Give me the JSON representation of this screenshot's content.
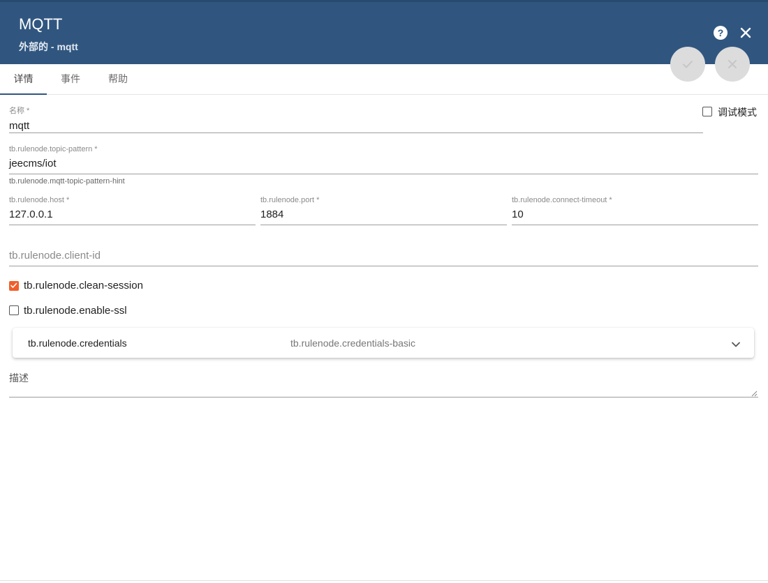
{
  "header": {
    "title": "MQTT",
    "subtitle": "外部的 - mqtt",
    "help_label": "?",
    "color": "#305680"
  },
  "tabs": [
    {
      "label": "详情",
      "active": true
    },
    {
      "label": "事件",
      "active": false
    },
    {
      "label": "帮助",
      "active": false
    }
  ],
  "form": {
    "name": {
      "label": "名称 *",
      "value": "mqtt"
    },
    "debug_mode": {
      "label": "调试模式",
      "checked": false
    },
    "topic_pattern": {
      "label": "tb.rulenode.topic-pattern *",
      "value": "jeecms/iot",
      "hint": "tb.rulenode.mqtt-topic-pattern-hint"
    },
    "host": {
      "label": "tb.rulenode.host *",
      "value": "127.0.0.1"
    },
    "port": {
      "label": "tb.rulenode.port *",
      "value": "1884"
    },
    "connect_timeout": {
      "label": "tb.rulenode.connect-timeout *",
      "value": "10"
    },
    "client_id": {
      "placeholder": "tb.rulenode.client-id",
      "value": ""
    },
    "clean_session": {
      "label": "tb.rulenode.clean-session",
      "checked": true
    },
    "enable_ssl": {
      "label": "tb.rulenode.enable-ssl",
      "checked": false
    },
    "credentials": {
      "title": "tb.rulenode.credentials",
      "description": "tb.rulenode.credentials-basic"
    },
    "description": {
      "label": "描述",
      "value": ""
    }
  },
  "colors": {
    "accent": "#f1602a",
    "header": "#305680"
  },
  "icons": {
    "help": "help-circle-icon",
    "close": "close-icon",
    "apply": "check-icon",
    "cancel": "cancel-icon",
    "expand": "chevron-down-icon"
  }
}
